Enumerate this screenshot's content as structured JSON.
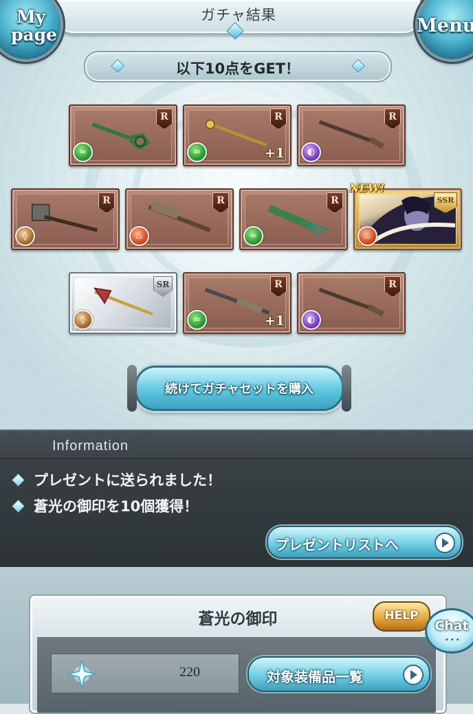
{
  "header": {
    "title": "ガチャ結果",
    "mypage_label_1": "My",
    "mypage_label_2": "page",
    "menu_label": "Menu"
  },
  "get_banner": {
    "label": "以下10点をGET！"
  },
  "items": [
    {
      "rarity": "R",
      "element": "wind",
      "plus": ""
    },
    {
      "rarity": "R",
      "element": "wind",
      "plus": "+1"
    },
    {
      "rarity": "R",
      "element": "dark",
      "plus": ""
    },
    {
      "rarity": "R",
      "element": "earth",
      "plus": ""
    },
    {
      "rarity": "R",
      "element": "fire",
      "plus": ""
    },
    {
      "rarity": "R",
      "element": "wind",
      "plus": ""
    },
    {
      "rarity": "SSR",
      "element": "fire",
      "plus": "",
      "new": "NEW!"
    },
    {
      "rarity": "SR",
      "element": "earth",
      "plus": ""
    },
    {
      "rarity": "R",
      "element": "wind",
      "plus": "+1"
    },
    {
      "rarity": "R",
      "element": "dark",
      "plus": ""
    }
  ],
  "buy_button": {
    "label": "続けてガチャセットを購入"
  },
  "information": {
    "heading": "Information",
    "lines": [
      "プレゼントに送られました！",
      "蒼光の御印を10個獲得！"
    ],
    "present_button": "プレゼントリストへ"
  },
  "seal_panel": {
    "title": "蒼光の御印",
    "help_label": "HELP",
    "count": "220",
    "list_button": "対象装備品一覧"
  },
  "chat": {
    "label": "Chat",
    "dots": "•••"
  },
  "colors": {
    "accent_cyan": "#5fc7df",
    "panel_dark": "#3c4448",
    "card_bronze": "#b98b7a"
  }
}
